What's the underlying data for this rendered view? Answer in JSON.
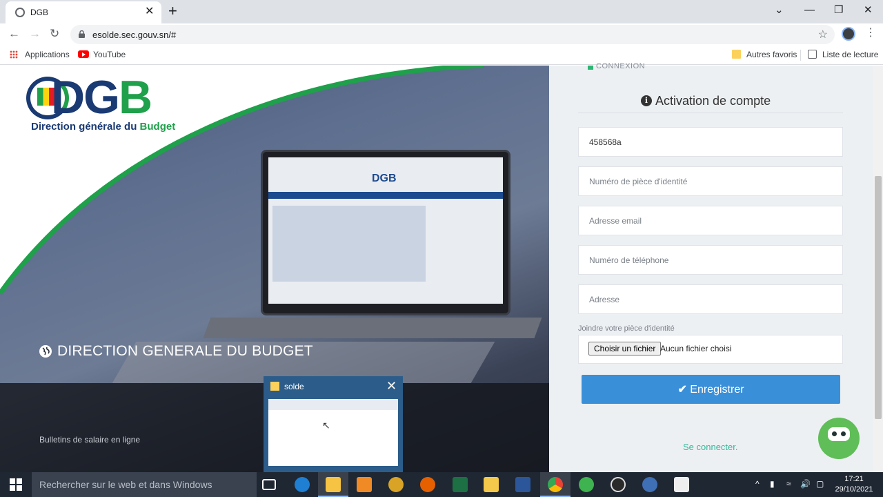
{
  "browser": {
    "tab_title": "DGB",
    "tab_close": "✕",
    "new_tab": "+",
    "url": "esolde.sec.gouv.sn/#",
    "window_controls": [
      "⌄",
      "—",
      "❐",
      "✕"
    ],
    "bookmarks": {
      "apps": "Applications",
      "youtube": "YouTube",
      "other": "Autres favoris",
      "reading_list": "Liste de lecture"
    }
  },
  "hero": {
    "logo": {
      "letters_main": "DG",
      "letters_accent": "B",
      "tagline_main": "Direction générale du ",
      "tagline_accent": "Budget"
    },
    "laptop_logo": "DGB",
    "title": "DIRECTION GENERALE DU BUDGET",
    "subtitle": "Bulletins de salaire en ligne"
  },
  "form": {
    "section_hint": "CONNEXION",
    "heading": "Activation de compte",
    "info_glyph": "i",
    "matricule_value": "458568a",
    "id_placeholder": "Numéro de pièce d'identité",
    "email_placeholder": "Adresse email",
    "phone_placeholder": "Numéro de téléphone",
    "address_placeholder": "Adresse",
    "file_label": "Joindre votre pièce d'identité",
    "file_button": "Choisir un fichier",
    "file_status": "Aucun fichier choisi",
    "submit_check": "✔",
    "submit_label": " Enregistrer",
    "login_link": "Se connecter."
  },
  "thumbnail": {
    "title": "solde",
    "close": "✕"
  },
  "taskbar": {
    "search_placeholder": "Rechercher sur le web et dans Windows",
    "time": "17:21",
    "date": "29/10/2021",
    "tray_arrow": "^"
  },
  "colors": {
    "accent_blue": "#3a8fd9",
    "brand_green": "#1fa04a",
    "brand_navy": "#1a3a73",
    "link_teal": "#35b89b"
  },
  "icons": {
    "taskbar": [
      "task-view-icon",
      "edge-icon",
      "file-explorer-icon",
      "media-player-icon",
      "audio-app-icon",
      "firefox-icon",
      "excel-icon",
      "folder-icon",
      "word-icon",
      "chrome-icon",
      "utorrent-icon",
      "obs-icon",
      "screen-recorder-icon",
      "clapper-icon"
    ]
  }
}
